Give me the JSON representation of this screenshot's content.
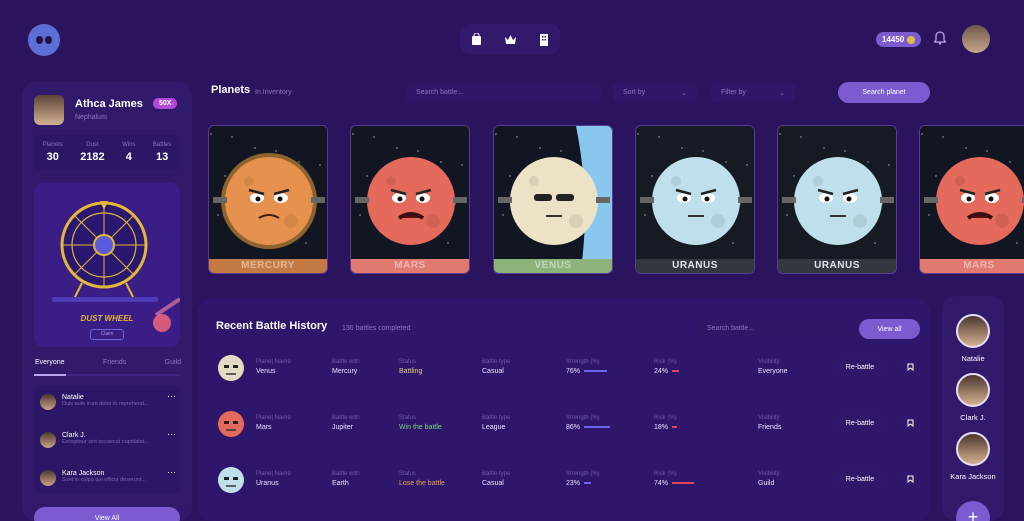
{
  "coins": "14450",
  "profile": {
    "name": "Athca James",
    "badge": "50X",
    "sub": "Nephalum",
    "stats": [
      {
        "label": "Planets",
        "value": "30"
      },
      {
        "label": "Dust",
        "value": "2182"
      },
      {
        "label": "Wins",
        "value": "4"
      },
      {
        "label": "Battles",
        "value": "13"
      }
    ]
  },
  "wheel": {
    "title": "DUST WHEEL",
    "button": "Claim"
  },
  "friend_tabs": [
    "Everyone",
    "Friends",
    "Guild"
  ],
  "friends": [
    {
      "name": "Natalie",
      "text": "Duis aute irure dolor in reprehend..."
    },
    {
      "name": "Clark J.",
      "text": "Excepteur sint occaecat cupidatat..."
    },
    {
      "name": "Kara Jackson",
      "text": "Sunt in culpa qui officia deserunt..."
    }
  ],
  "view_all": "View All",
  "planets_section": {
    "title": "Planets",
    "subtitle": "In Inventory",
    "search_placeholder": "Search battle...",
    "sort": "Sort by",
    "filter": "Filter by",
    "search_btn": "Search planet"
  },
  "planet_cards": [
    "MERCURY",
    "MARS",
    "VENUS",
    "URANUS",
    "URANUS",
    "MARS"
  ],
  "history": {
    "title": "Recent Battle History",
    "subtitle": "136 battles completed",
    "search_placeholder": "Search battle...",
    "view_all": "View all",
    "headers": {
      "planet": "Planet Name",
      "with": "Battle with",
      "status": "Status",
      "type": "Battle type",
      "strength": "Strength (%)",
      "risk": "Risk (%)",
      "visibility": "Visibility"
    },
    "rebattle": "Re-battle",
    "rows": [
      {
        "planet": "Venus",
        "with": "Mercury",
        "status": "Battling",
        "type": "Casual",
        "strength": "76%",
        "risk": "24%",
        "visibility": "Everyone"
      },
      {
        "planet": "Mars",
        "with": "Jupiter",
        "status": "Win the battle",
        "type": "League",
        "strength": "86%",
        "risk": "18%",
        "visibility": "Friends"
      },
      {
        "planet": "Uranus",
        "with": "Earth",
        "status": "Lose the battle",
        "type": "Casual",
        "strength": "23%",
        "risk": "74%",
        "visibility": "Guild"
      }
    ]
  },
  "right_friends": [
    "Natalie",
    "Clark J.",
    "Kara Jackson"
  ],
  "colors": {
    "bg": "#2b145e",
    "panel": "#321a6b",
    "accent": "#7c5bd0",
    "battling": "#e8d27a",
    "win": "#7bd67b",
    "lose": "#f0a050"
  }
}
